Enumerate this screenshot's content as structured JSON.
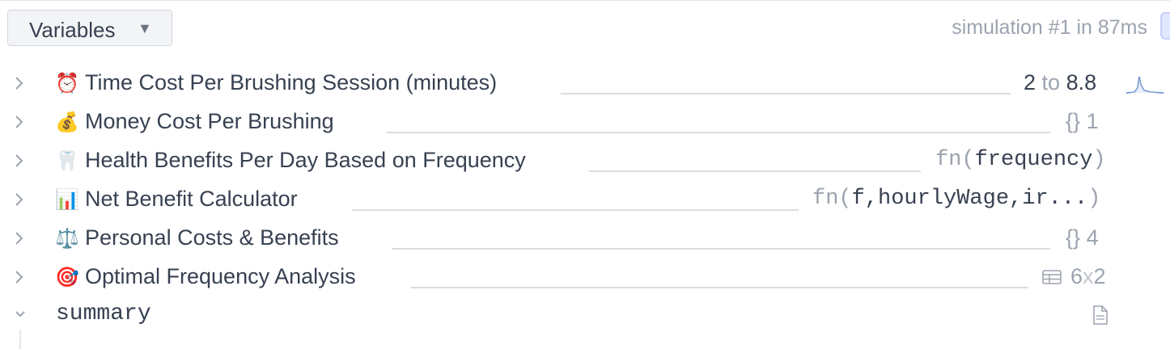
{
  "header": {
    "variables_button_label": "Variables",
    "caret_icon": "triangle-down-icon",
    "simulation_status": "simulation #1 in 87ms"
  },
  "rows": [
    {
      "emoji": "⏰",
      "label": "Time Cost Per Brushing Session (minutes)",
      "value": {
        "type": "range",
        "from": "2",
        "connector": "to",
        "to": "8.8"
      },
      "expanded": false
    },
    {
      "emoji": "💰",
      "label": "Money Cost Per Brushing",
      "value": {
        "type": "dict",
        "braces": "{}",
        "count": "1"
      },
      "expanded": false
    },
    {
      "emoji": "🦷",
      "label": "Health Benefits Per Day Based on Frequency",
      "value": {
        "type": "function",
        "prefix": "fn(",
        "args": "frequency",
        "suffix": ")"
      },
      "expanded": false
    },
    {
      "emoji": "📊",
      "label": "Net Benefit Calculator",
      "value": {
        "type": "function",
        "prefix": "fn(",
        "args": "f,hourlyWage,ir...",
        "suffix": ")"
      },
      "expanded": false
    },
    {
      "emoji": "⚖️",
      "label": "Personal Costs & Benefits",
      "value": {
        "type": "dict",
        "braces": "{}",
        "count": "4"
      },
      "expanded": false
    },
    {
      "emoji": "🎯",
      "label": "Optimal Frequency Analysis",
      "value": {
        "type": "table",
        "rows": "6",
        "cross": "x",
        "cols": "2"
      },
      "expanded": false
    },
    {
      "emoji": "",
      "label": "summary",
      "value": {
        "type": "document"
      },
      "expanded": true
    }
  ],
  "icons": {
    "collapsed": "chevron-right-icon",
    "expanded": "chevron-down-icon",
    "distribution": "distribution-sparkline-icon",
    "table": "table-icon",
    "document": "document-icon"
  },
  "colors": {
    "text": "#374151",
    "muted": "#9ca3af",
    "rule": "#d9dce2",
    "sparkline": "#4f7fc8"
  }
}
